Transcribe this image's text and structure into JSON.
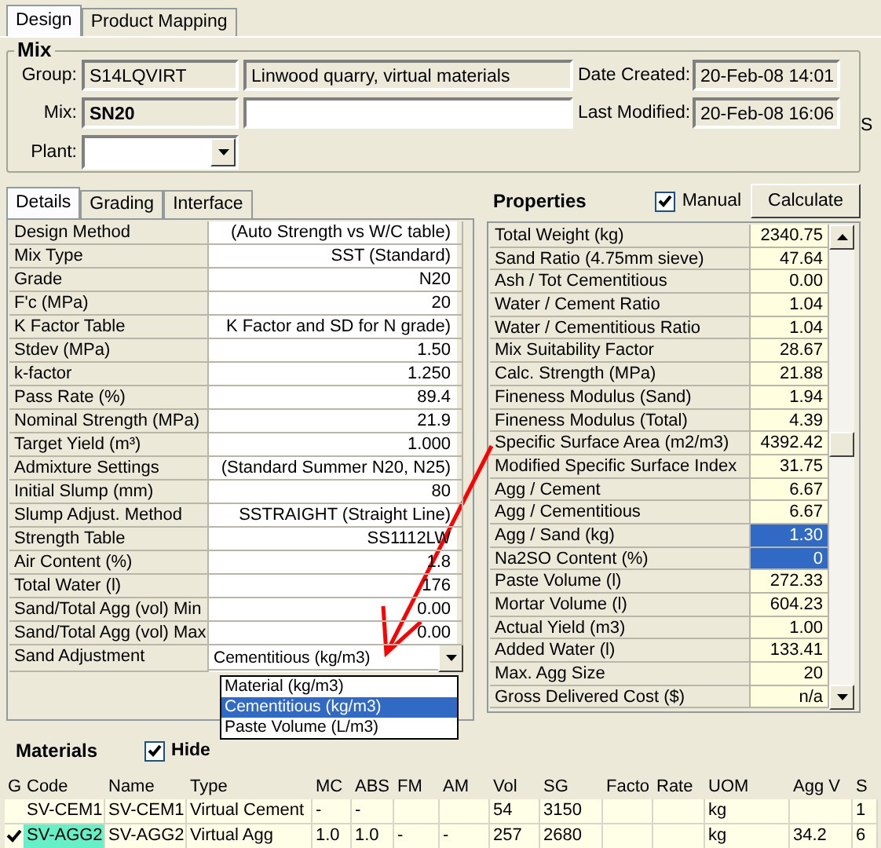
{
  "tabs": [
    {
      "label": "Design",
      "selected": true
    },
    {
      "label": "Product Mapping",
      "selected": false
    }
  ],
  "mix": {
    "title": "Mix",
    "group_label": "Group:",
    "group": "S14LQVIRT",
    "group_description": "Linwood quarry, virtual materials",
    "mix_label": "Mix:",
    "mix": "SN20",
    "plant_label": "Plant:",
    "date_created_label": "Date Created:",
    "date_created": "20-Feb-08 14:01",
    "last_modified_label": "Last Modified:",
    "last_modified": "20-Feb-08 16:06"
  },
  "right_edge_label": "S",
  "detail_tabs": [
    {
      "label": "Details",
      "selected": true
    },
    {
      "label": "Grading",
      "selected": false
    },
    {
      "label": "Interface",
      "selected": false
    }
  ],
  "details": [
    {
      "label": "Design Method",
      "value": "(Auto Strength vs W/C table)"
    },
    {
      "label": "Mix Type",
      "value": "SST (Standard)"
    },
    {
      "label": "Grade",
      "value": "N20"
    },
    {
      "label": "F'c (MPa)",
      "value": "20"
    },
    {
      "label": "K Factor Table",
      "value": "K Factor and SD for N grade)"
    },
    {
      "label": "Stdev (MPa)",
      "value": "1.50"
    },
    {
      "label": "k-factor",
      "value": "1.250"
    },
    {
      "label": "Pass Rate (%)",
      "value": "89.4"
    },
    {
      "label": "Nominal Strength (MPa)",
      "value": "21.9"
    },
    {
      "label": "Target Yield (m³)",
      "value": "1.000"
    },
    {
      "label": "Admixture Settings",
      "value": "(Standard Summer N20, N25)"
    },
    {
      "label": "Initial Slump (mm)",
      "value": "80"
    },
    {
      "label": "Slump Adjust. Method",
      "value": "SSTRAIGHT (Straight Line)"
    },
    {
      "label": "Strength Table",
      "value": "SS1112LW"
    },
    {
      "label": "Air Content (%)",
      "value": "1.8"
    },
    {
      "label": "Total Water (l)",
      "value": "176"
    },
    {
      "label": "Sand/Total Agg (vol) Min",
      "value": "0.00"
    },
    {
      "label": "Sand/Total Agg (vol) Max",
      "value": "0.00"
    }
  ],
  "sand_adjustment": {
    "label": "Sand Adjustment",
    "value": "Cementitious (kg/m3)",
    "options": [
      {
        "label": "Material (kg/m3)",
        "selected": false
      },
      {
        "label": "Cementitious (kg/m3)",
        "selected": true
      },
      {
        "label": "Paste Volume (L/m3)",
        "selected": false
      }
    ]
  },
  "properties": {
    "title": "Properties",
    "manual": {
      "label": "Manual",
      "checked": true
    },
    "calculate_button": "Calculate",
    "rows": [
      {
        "label": "Total Weight (kg)",
        "value": "2340.75",
        "selected": false
      },
      {
        "label": "Sand Ratio (4.75mm sieve)",
        "value": "47.64",
        "selected": false
      },
      {
        "label": "Ash / Tot Cementitious",
        "value": "0.00",
        "selected": false
      },
      {
        "label": "Water / Cement Ratio",
        "value": "1.04",
        "selected": false
      },
      {
        "label": "Water / Cementitious Ratio",
        "value": "1.04",
        "selected": false
      },
      {
        "label": "Mix Suitability Factor",
        "value": "28.67",
        "selected": false
      },
      {
        "label": "Calc. Strength (MPa)",
        "value": "21.88",
        "selected": false
      },
      {
        "label": "Fineness Modulus (Sand)",
        "value": "1.94",
        "selected": false
      },
      {
        "label": "Fineness Modulus (Total)",
        "value": "4.39",
        "selected": false
      },
      {
        "label": "Specific Surface Area (m2/m3)",
        "value": "4392.42",
        "selected": false
      },
      {
        "label": "Modified Specific Surface Index",
        "value": "31.75",
        "selected": false
      },
      {
        "label": "Agg / Cement",
        "value": "6.67",
        "selected": false
      },
      {
        "label": "Agg / Cementitious",
        "value": "6.67",
        "selected": false
      },
      {
        "label": "Agg / Sand (kg)",
        "value": "1.30",
        "selected": true
      },
      {
        "label": "Na2SO Content (%)",
        "value": "0",
        "selected": true
      },
      {
        "label": "Paste Volume (l)",
        "value": "272.33",
        "selected": false
      },
      {
        "label": "Mortar Volume (l)",
        "value": "604.23",
        "selected": false
      },
      {
        "label": "Actual Yield (m3)",
        "value": "1.00",
        "selected": false
      },
      {
        "label": "Added Water (l)",
        "value": "133.41",
        "selected": false
      },
      {
        "label": "Max. Agg Size",
        "value": "20",
        "selected": false
      },
      {
        "label": "Gross Delivered Cost ($)",
        "value": "n/a",
        "selected": false
      }
    ]
  },
  "materials": {
    "title": "Materials",
    "hide": {
      "label": "Hide",
      "checked": true
    },
    "columns": [
      "G",
      "Code",
      "Name",
      "Type",
      "MC",
      "ABS",
      "FM",
      "AM",
      "Vol",
      "SG",
      "Facto",
      "Rate",
      "UOM",
      "Agg V",
      "S"
    ],
    "rows": [
      {
        "checked": false,
        "selected": false,
        "cells": [
          "",
          "SV-CEM1",
          "SV-CEM1",
          "Virtual Cement",
          "-",
          "-",
          "",
          "",
          "54",
          "3150",
          "",
          "",
          "kg",
          "",
          "1"
        ]
      },
      {
        "checked": true,
        "selected": true,
        "cells": [
          "",
          "SV-AGG2",
          "SV-AGG2",
          "Virtual Agg",
          "1.0",
          "1.0",
          "-",
          "-",
          "257",
          "2680",
          "",
          "",
          "kg",
          "34.2",
          "6"
        ]
      }
    ]
  }
}
